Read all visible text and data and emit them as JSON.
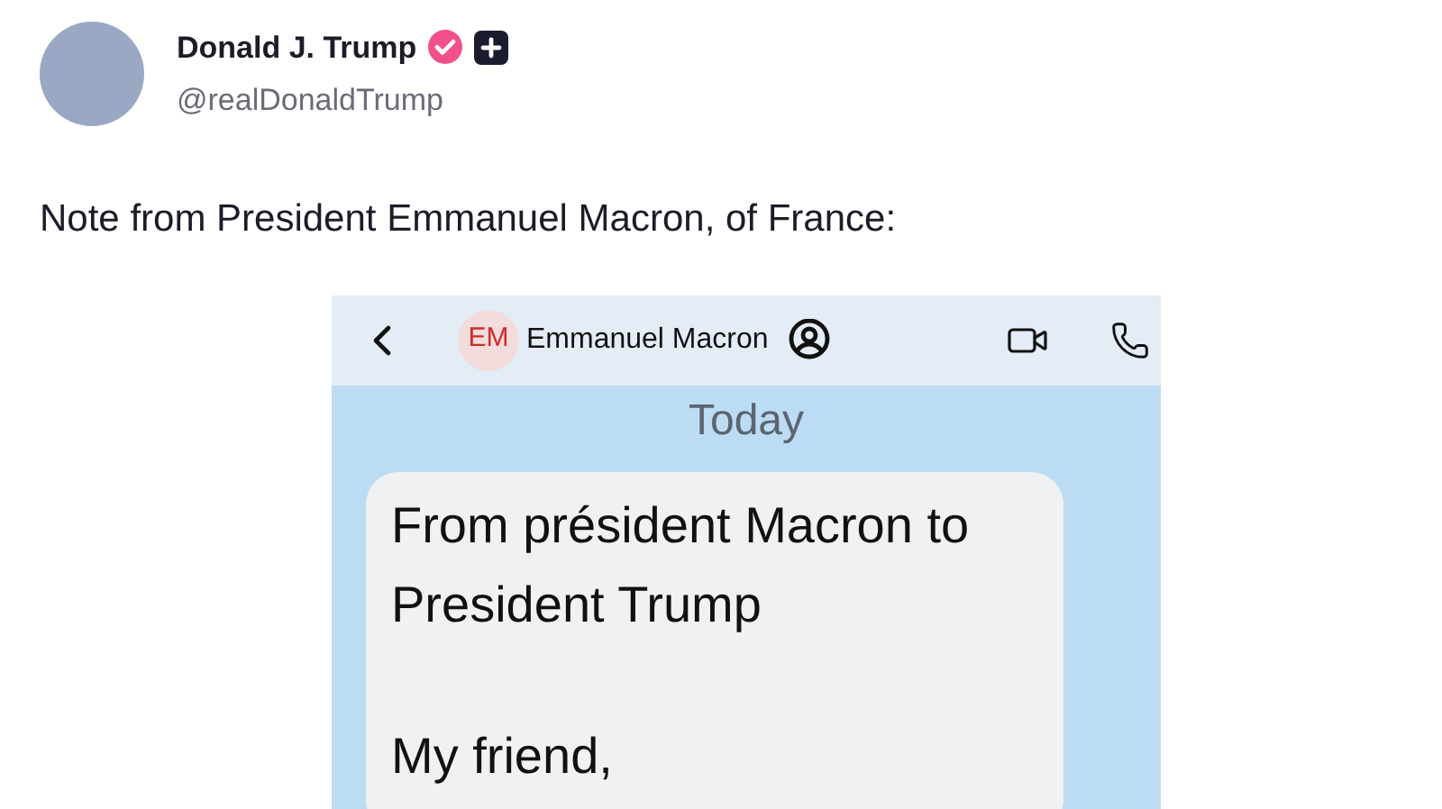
{
  "author": {
    "name": "Donald J. Trump",
    "handle": "@realDonaldTrump"
  },
  "post": {
    "text": "Note from President Emmanuel Macron, of France:"
  },
  "chat": {
    "initials": "EM",
    "contact": "Emmanuel Macron",
    "day": "Today",
    "messages": [
      {
        "paragraphs": [
          "From président Macron to President Trump",
          "My friend,"
        ]
      }
    ]
  }
}
